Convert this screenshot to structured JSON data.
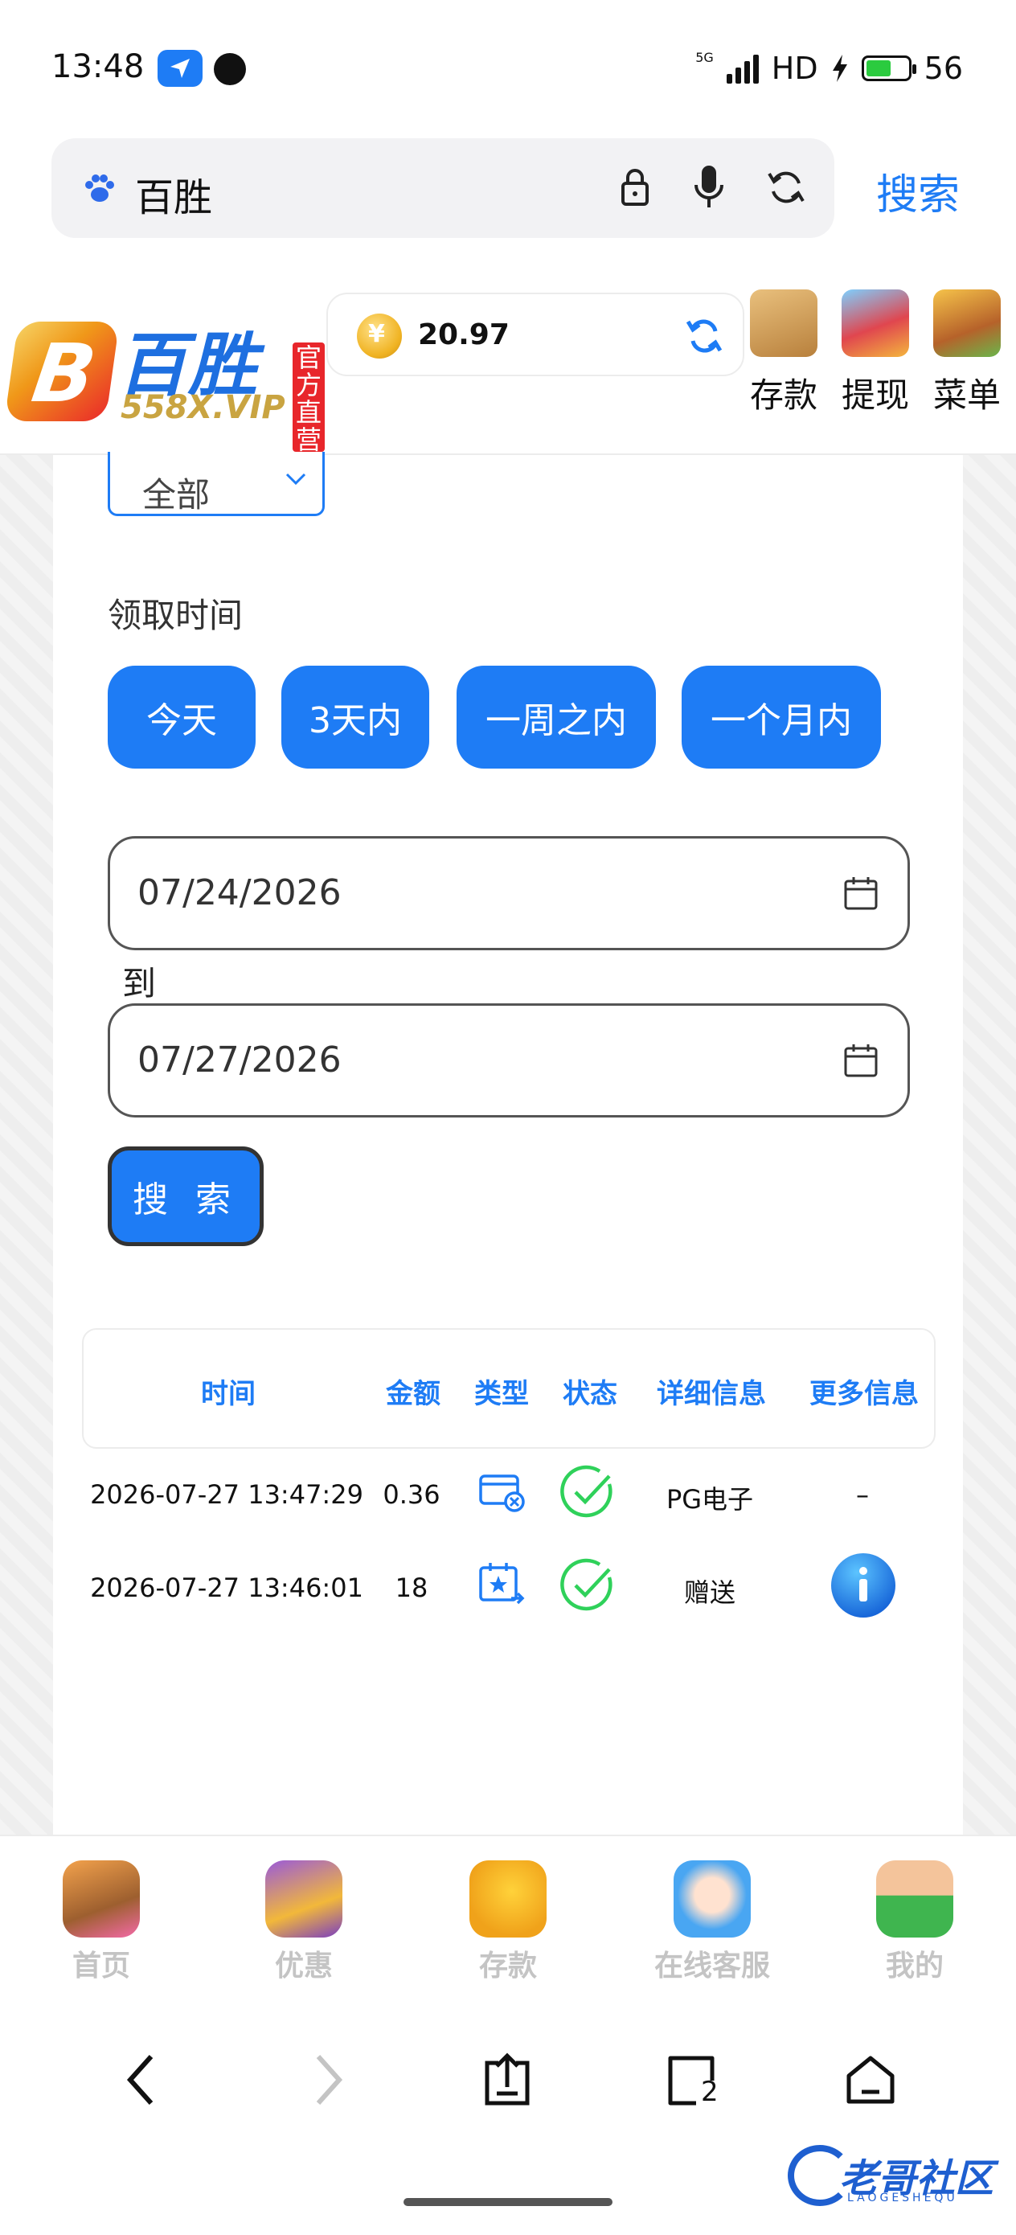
{
  "status_bar": {
    "time": "13:48",
    "network": "5G",
    "hd": "HD",
    "battery": "56",
    "icons": [
      "navigation-arrow-icon",
      "record-dot-icon",
      "signal-icon",
      "charging-bolt-icon",
      "battery-icon"
    ]
  },
  "browser": {
    "query": "百胜",
    "search_action": "搜索",
    "icons": [
      "paw-icon",
      "lock-icon",
      "microphone-icon",
      "refresh-icon"
    ]
  },
  "site_header": {
    "logo_cn": "百胜",
    "logo_url": "558X.VIP",
    "logo_tag": "官方直营",
    "balance": "20.97",
    "actions": [
      "存款",
      "提现",
      "菜单"
    ]
  },
  "filter": {
    "type_selected": "全部",
    "time_label": "领取时间",
    "chips": [
      "今天",
      "3天内",
      "一周之内",
      "一个月内"
    ],
    "date_from": "07/24/2026",
    "to_label": "到",
    "date_to": "07/27/2026",
    "search_button": "搜 索"
  },
  "table": {
    "headers": [
      "时间",
      "金额",
      "类型",
      "状态",
      "详细信息",
      "更多信息"
    ],
    "rows": [
      {
        "time": "2026-07-27 13:47:29",
        "amount": "0.36",
        "type_icon": "card-cancel-icon",
        "status_icon": "check-circle-icon",
        "detail": "PG电子",
        "more": "–"
      },
      {
        "time": "2026-07-27 13:46:01",
        "amount": "18",
        "type_icon": "calendar-star-icon",
        "status_icon": "check-circle-icon",
        "detail": "赠送",
        "more_icon": "info-icon"
      }
    ]
  },
  "bottom_nav": {
    "items": [
      "首页",
      "优惠",
      "存款",
      "在线客服",
      "我的"
    ]
  },
  "browser_toolbar": {
    "tab_count": "2",
    "icons": [
      "back-icon",
      "forward-icon",
      "share-icon",
      "tabs-icon",
      "home-icon"
    ]
  },
  "watermark": {
    "text": "老哥社区",
    "sub": "LAOGESHEQU"
  },
  "colors": {
    "accent": "#1e7cf5",
    "success": "#2fd15a",
    "nav_inactive": "#c4c4c4",
    "logo_tag": "#e8262b"
  }
}
